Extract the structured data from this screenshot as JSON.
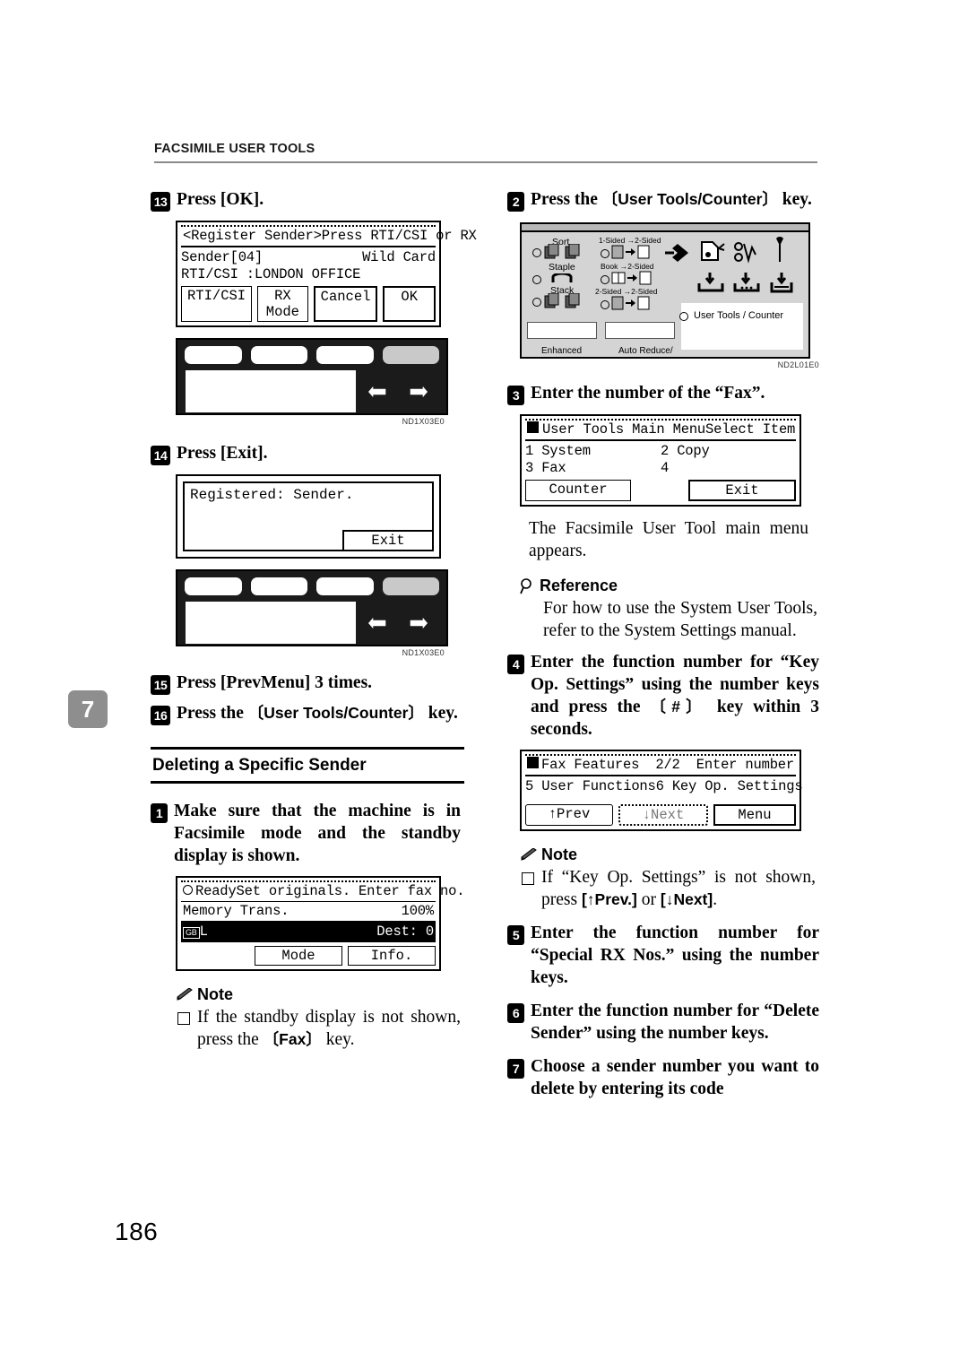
{
  "header": {
    "title": "FACSIMILE USER TOOLS"
  },
  "chapter_tab": "7",
  "folio": "186",
  "left_column": {
    "step13": {
      "num": "13",
      "text_pre": "Press ",
      "text_key": "[OK]",
      "text_post": "."
    },
    "lcd_register_sender": {
      "title_left": "<Register Sender>",
      "title_right": "Press RTI/CSI or RX",
      "line1_left": "Sender[04]",
      "line1_right": "Wild Card",
      "line2": "RTI/CSI :LONDON OFFICE",
      "buttons": [
        "RTI/CSI",
        "RX Mode",
        "Cancel",
        "OK"
      ]
    },
    "panel_code_1": "ND1X03E0",
    "step14": {
      "num": "14",
      "text_pre": "Press ",
      "text_key": "[Exit]",
      "text_post": "."
    },
    "lcd_registered": {
      "message": "Registered: Sender.",
      "button": "Exit"
    },
    "panel_code_2": "ND1X03E0",
    "step15": {
      "num": "15",
      "text_pre": "Press ",
      "text_key": "[PrevMenu]",
      "text_post": " 3 times."
    },
    "step16": {
      "num": "16",
      "text_pre": "Press the ",
      "text_key": "〔User Tools/Counter〕",
      "text_post": " key."
    },
    "section_heading": "Deleting a Specific Sender",
    "step1": {
      "num": "1",
      "text": "Make sure that the machine is in Facsimile mode and the standby display is shown."
    },
    "lcd_standby": {
      "status": "Ready",
      "prompt": "Set originals. Enter fax no.",
      "mode": "Memory Trans.",
      "percent": "100%",
      "dest_label": "Dest:",
      "dest_value": "0",
      "buttons": [
        "Mode",
        "Info."
      ]
    },
    "note": {
      "title": "Note",
      "icon": "pencil-icon",
      "items_pre": "If the standby display is not shown, press the ",
      "items_key": "〔Fax〕",
      "items_post": " key."
    }
  },
  "right_column": {
    "step2": {
      "num": "2",
      "text_pre": "Press the ",
      "text_key": "〔User Tools/Counter〕",
      "text_post": " key."
    },
    "machine_panel": {
      "sort": "Sort",
      "staple": "Staple",
      "stack": "Stack",
      "dup1": "1-Sided →2-Sided",
      "dup2": "Book →2-Sided",
      "dup3": "2-Sided →2-Sided",
      "user_tools": "User Tools / Counter",
      "bottom_left": "Enhanced",
      "bottom_mid": "Auto Reduce/",
      "code": "ND2L01E0"
    },
    "step3": {
      "num": "3",
      "text": "Enter the number of the “Fax”."
    },
    "lcd_user_tools": {
      "title_left": "User Tools Main Menu",
      "title_right": "Select Item",
      "item1": "1 System",
      "item2": "2 Copy",
      "item3": "3 Fax",
      "item4": "4",
      "btn_left": "Counter",
      "btn_right": "Exit"
    },
    "step3_caption": "The Facsimile User Tool main menu appears.",
    "reference": {
      "title": "Reference",
      "icon": "magnifier-icon",
      "body": "For how to use the System User Tools, refer to the System Settings manual."
    },
    "step4": {
      "num": "4",
      "text_a": "Enter the function number for “Key Op. Settings” using the number keys and press the ",
      "text_key": "〔#〕",
      "text_b": " key within 3 seconds."
    },
    "lcd_fax_features": {
      "title_left": "Fax Features",
      "title_mid": "2/2",
      "title_right": "Enter number",
      "item5": "5 User Functions",
      "item6": "6 Key Op. Settings",
      "btn_prev": "↑Prev",
      "btn_next": "↓Next",
      "btn_menu": "Menu"
    },
    "note": {
      "title": "Note",
      "icon": "pencil-icon",
      "text_a": "If “Key Op. Settings” is not shown, press ",
      "key1": "[↑Prev.]",
      "text_b": " or ",
      "key2": "[↓Next]",
      "text_c": "."
    },
    "step5": {
      "num": "5",
      "text": "Enter the function number for “Special RX Nos.” using the number keys."
    },
    "step6": {
      "num": "6",
      "text": "Enter the function number for “Delete Sender” using the number keys."
    },
    "step7": {
      "num": "7",
      "text": "Choose a sender number you want to delete by entering its code"
    }
  }
}
